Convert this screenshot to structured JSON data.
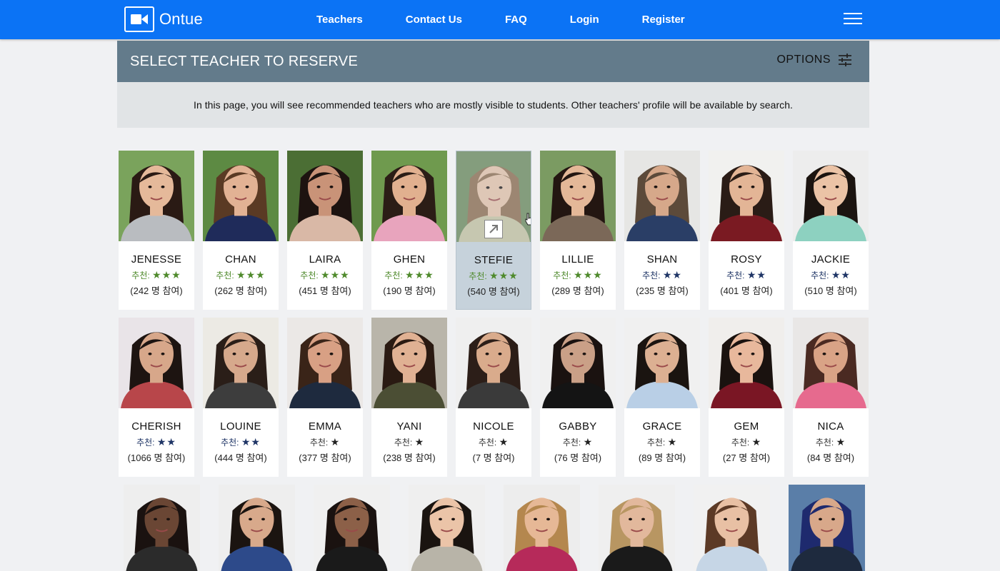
{
  "app": {
    "logo_text": "Ontue",
    "nav": [
      "Teachers",
      "Contact Us",
      "FAQ",
      "Login",
      "Register"
    ]
  },
  "header": {
    "title": "SELECT TEACHER TO RESERVE",
    "options_label": "OPTIONS",
    "notice": "In this page, you will see recommended teachers who are mostly visible to students. Other teachers' profile will be available by search."
  },
  "rec_label": "추천:",
  "colors": {
    "three_star": "#4f8a2c",
    "two_star": "#1f3566",
    "one_star": "#222222",
    "navbar": "#0b73f5",
    "panel": "#637b8b"
  },
  "teachers_row1": [
    {
      "name": "JENESSE",
      "stars": 3,
      "participants": "(242 명 참여)",
      "bg": "#7aa35c",
      "skin": "#e5b99a",
      "hair": "#2a1a14",
      "shirt": "#b9bcc0"
    },
    {
      "name": "CHAN",
      "stars": 3,
      "participants": "(262 명 참여)",
      "bg": "#5d8a43",
      "skin": "#e2b294",
      "hair": "#5a3a24",
      "shirt": "#1f2b5a"
    },
    {
      "name": "LAIRA",
      "stars": 3,
      "participants": "(451 명 참여)",
      "bg": "#4b6e34",
      "skin": "#c99378",
      "hair": "#1d1310",
      "shirt": "#d9b8a6"
    },
    {
      "name": "GHEN",
      "stars": 3,
      "participants": "(190 명 참여)",
      "bg": "#6f9a4e",
      "skin": "#e1b08f",
      "hair": "#2b1d16",
      "shirt": "#e8a4bd"
    },
    {
      "name": "STEFIE",
      "stars": 3,
      "participants": "(540 명 참여)",
      "bg": "#6b8a5a",
      "skin": "#e8c4a8",
      "hair": "#8c6a4a",
      "shirt": "#c7c3a0"
    },
    {
      "name": "LILLIE",
      "stars": 3,
      "participants": "(289 명 참여)",
      "bg": "#7b9b62",
      "skin": "#e4b898",
      "hair": "#231611",
      "shirt": "#7b6858"
    },
    {
      "name": "SHAN",
      "stars": 2,
      "participants": "(235 명 참여)",
      "bg": "#e6e6e4",
      "skin": "#d6a88a",
      "hair": "#5c4a3a",
      "shirt": "#2a3e66"
    },
    {
      "name": "ROSY",
      "stars": 2,
      "participants": "(401 명 참여)",
      "bg": "#f1f1ef",
      "skin": "#e3b596",
      "hair": "#2a1c16",
      "shirt": "#7a1a22"
    },
    {
      "name": "JACKIE",
      "stars": 2,
      "participants": "(510 명 참여)",
      "bg": "#ededed",
      "skin": "#ebc3a6",
      "hair": "#1b1410",
      "shirt": "#8dd1c0"
    }
  ],
  "teachers_row2": [
    {
      "name": "CHERISH",
      "stars": 2,
      "participants": "(1066 명 참여)",
      "bg": "#e9e4e8",
      "skin": "#d7a78a",
      "hair": "#1d1411",
      "shirt": "#b8464a"
    },
    {
      "name": "LOUINE",
      "stars": 2,
      "participants": "(444 명 참여)",
      "bg": "#eceae4",
      "skin": "#d6a98c",
      "hair": "#2a1e18",
      "shirt": "#3d3d3d"
    },
    {
      "name": "EMMA",
      "stars": 1,
      "participants": "(377 명 참여)",
      "bg": "#ebe8e6",
      "skin": "#d8a084",
      "hair": "#3a2418",
      "shirt": "#1e2a3e"
    },
    {
      "name": "YANI",
      "stars": 1,
      "participants": "(238 명 참여)",
      "bg": "#b9b5aa",
      "skin": "#e0b193",
      "hair": "#2a1a12",
      "shirt": "#4b4e34"
    },
    {
      "name": "NICOLE",
      "stars": 1,
      "participants": "(7 명 참여)",
      "bg": "#efefef",
      "skin": "#d9ab8c",
      "hair": "#2c1e18",
      "shirt": "#3a3a3a"
    },
    {
      "name": "GABBY",
      "stars": 1,
      "participants": "(76 명 참여)",
      "bg": "#f0f0f0",
      "skin": "#caa087",
      "hair": "#1a1210",
      "shirt": "#141414"
    },
    {
      "name": "GRACE",
      "stars": 1,
      "participants": "(89 명 참여)",
      "bg": "#f0f0f0",
      "skin": "#dcb092",
      "hair": "#1a1410",
      "shirt": "#b9cfe6"
    },
    {
      "name": "GEM",
      "stars": 1,
      "participants": "(27 명 참여)",
      "bg": "#f0eeec",
      "skin": "#e8b89c",
      "hair": "#1a120f",
      "shirt": "#7a1624"
    },
    {
      "name": "NICA",
      "stars": 1,
      "participants": "(84 명 참여)",
      "bg": "#e9e7e6",
      "skin": "#d9a386",
      "hair": "#4a2a22",
      "shirt": "#e66a8e"
    }
  ],
  "row3_photos": [
    {
      "bg": "#eeeeee",
      "skin": "#6a4634",
      "hair": "#1a1210",
      "shirt": "#2b2b2b"
    },
    {
      "bg": "#eeeeee",
      "skin": "#d8a98b",
      "hair": "#1b1410",
      "shirt": "#2d4a8a"
    },
    {
      "bg": "#f0f0f0",
      "skin": "#8c6048",
      "hair": "#1a1210",
      "shirt": "#1a1a1a"
    },
    {
      "bg": "#efefef",
      "skin": "#ebc4a8",
      "hair": "#1a1410",
      "shirt": "#b8b4a8"
    },
    {
      "bg": "#ededed",
      "skin": "#e6b896",
      "hair": "#b4874e",
      "shirt": "#b62a5a"
    },
    {
      "bg": "#efefef",
      "skin": "#e2b89c",
      "hair": "#b89662",
      "shirt": "#1a1a1a"
    },
    {
      "bg": "#f1f1f1",
      "skin": "#e8c0a4",
      "hair": "#5c3a26",
      "shirt": "#c6d6e6"
    },
    {
      "bg": "#5a7ea8",
      "skin": "#d8a88a",
      "hair": "#1e2a6e",
      "shirt": "#1e2a3e"
    }
  ]
}
